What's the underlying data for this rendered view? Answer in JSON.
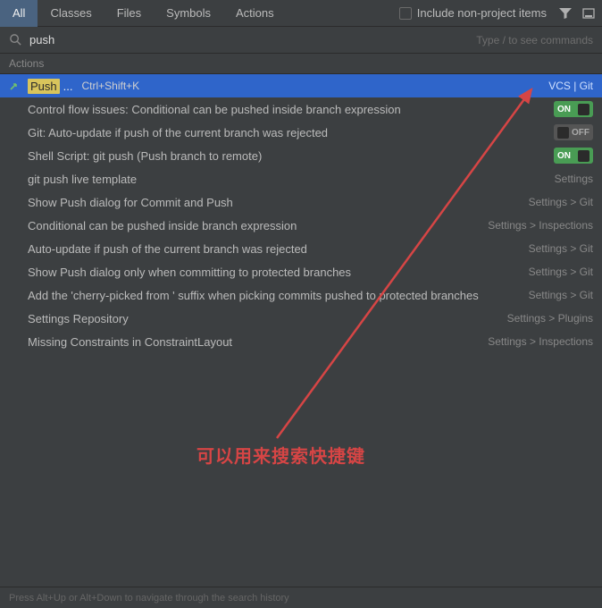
{
  "tabs": {
    "items": [
      "All",
      "Classes",
      "Files",
      "Symbols",
      "Actions"
    ],
    "active_index": 0
  },
  "include_checkbox": {
    "label": "Include non-project items",
    "checked": false
  },
  "search": {
    "value": "push",
    "hint": "Type / to see commands"
  },
  "section_label": "Actions",
  "results": [
    {
      "highlight": "Push",
      "label_rest": "...",
      "shortcut": "Ctrl+Shift+K",
      "tail_text": "VCS | Git",
      "toggle": null,
      "selected": true,
      "icon": "arrow"
    },
    {
      "highlight": null,
      "label_rest": "Control flow issues: Conditional can be pushed inside branch expression",
      "shortcut": null,
      "tail_text": null,
      "toggle": "ON",
      "selected": false,
      "icon": null
    },
    {
      "highlight": null,
      "label_rest": "Git: Auto-update if push of the current branch was rejected",
      "shortcut": null,
      "tail_text": null,
      "toggle": "OFF",
      "selected": false,
      "icon": null
    },
    {
      "highlight": null,
      "label_rest": "Shell Script: git push (Push branch to remote)",
      "shortcut": null,
      "tail_text": null,
      "toggle": "ON",
      "selected": false,
      "icon": null
    },
    {
      "highlight": null,
      "label_rest": "git push live template",
      "shortcut": null,
      "tail_text": "Settings",
      "toggle": null,
      "selected": false,
      "icon": null
    },
    {
      "highlight": null,
      "label_rest": "Show Push dialog for Commit and Push",
      "shortcut": null,
      "tail_text": "Settings > Git",
      "toggle": null,
      "selected": false,
      "icon": null
    },
    {
      "highlight": null,
      "label_rest": "Conditional can be pushed inside branch expression",
      "shortcut": null,
      "tail_text": "Settings > Inspections",
      "toggle": null,
      "selected": false,
      "icon": null
    },
    {
      "highlight": null,
      "label_rest": "Auto-update if push of the current branch was rejected",
      "shortcut": null,
      "tail_text": "Settings > Git",
      "toggle": null,
      "selected": false,
      "icon": null
    },
    {
      "highlight": null,
      "label_rest": "Show Push dialog only when committing to protected branches",
      "shortcut": null,
      "tail_text": "Settings > Git",
      "toggle": null,
      "selected": false,
      "icon": null
    },
    {
      "highlight": null,
      "label_rest": "Add the 'cherry-picked from ' suffix when picking commits pushed to protected branches",
      "shortcut": null,
      "tail_text": "Settings > Git",
      "toggle": null,
      "selected": false,
      "icon": null
    },
    {
      "highlight": null,
      "label_rest": "Settings Repository",
      "shortcut": null,
      "tail_text": "Settings > Plugins",
      "toggle": null,
      "selected": false,
      "icon": null
    },
    {
      "highlight": null,
      "label_rest": "Missing Constraints in ConstraintLayout",
      "shortcut": null,
      "tail_text": "Settings > Inspections",
      "toggle": null,
      "selected": false,
      "icon": null
    }
  ],
  "annotation_text": "可以用来搜索快捷键",
  "footer_text": "Press Alt+Up or Alt+Down to navigate through the search history"
}
